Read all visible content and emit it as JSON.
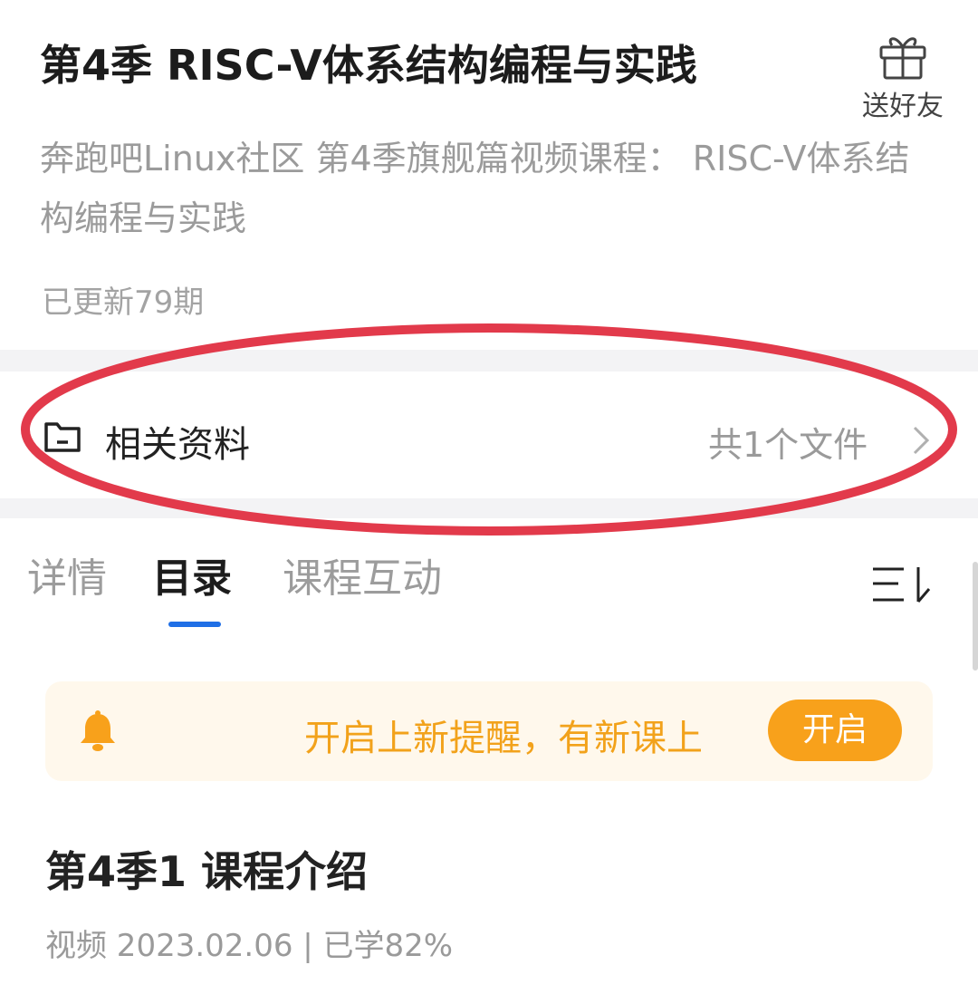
{
  "course": {
    "title": "第4季 RISC-V体系结构编程与实践",
    "subtitle": "奔跑吧Linux社区 第4季旗舰篇视频课程： RISC-V体系结构编程与实践",
    "updated": "已更新79期"
  },
  "gift": {
    "label": "送好友",
    "icon": "gift-icon"
  },
  "materials": {
    "icon": "folder-icon",
    "label": "相关资料",
    "count": "共1个文件",
    "chevron": "chevron-right-icon",
    "highlight_color": "#e23a4b"
  },
  "tabs": [
    {
      "label": "详情",
      "active": false
    },
    {
      "label": "目录",
      "active": true
    },
    {
      "label": "课程互动",
      "active": false
    }
  ],
  "sort": {
    "icon": "sort-icon"
  },
  "reminder": {
    "icon": "bell-icon",
    "text": "开启上新提醒，有新课上",
    "button": "开启",
    "accent": "#f8a11b"
  },
  "lessons": [
    {
      "title": "第4季1 课程介绍",
      "meta": "视频 2023.02.06 | 已学82%"
    }
  ],
  "colors": {
    "tab_indicator": "#1f6fe6"
  }
}
